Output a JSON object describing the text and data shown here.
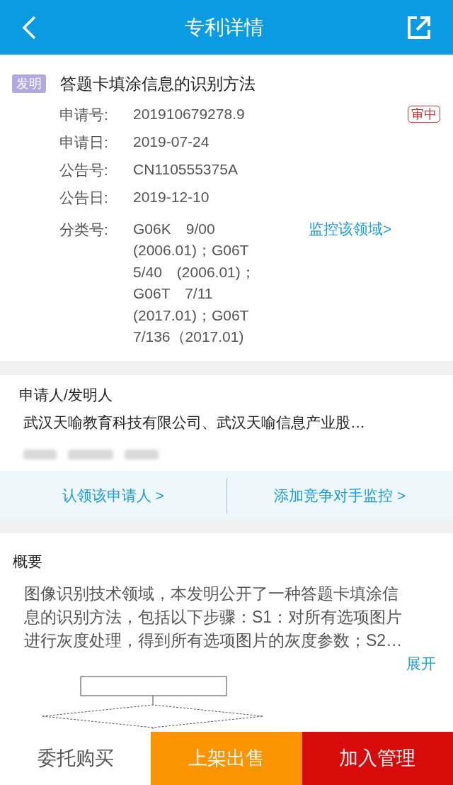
{
  "header": {
    "title": "专利详情"
  },
  "patent": {
    "type_tag": "发明",
    "title": "答题卡填涂信息的识别方法",
    "status": "审中",
    "fields": [
      {
        "label": "申请号:",
        "value": "201910679278.9"
      },
      {
        "label": "申请日:",
        "value": "2019-07-24"
      },
      {
        "label": "公告号:",
        "value": "CN110555375A"
      },
      {
        "label": "公告日:",
        "value": "2019-12-10"
      },
      {
        "label": "分类号:",
        "value": "G06K　9/00\n(2006.01)；G06T\n5/40　(2006.01)；\nG06T　7/11\n(2017.01)；G06T\n7/136（2017.01)"
      }
    ],
    "monitor_link": "监控该领域>"
  },
  "applicants": {
    "heading": "申请人/发明人",
    "names": "武汉天喻教育科技有限公司、武汉天喻信息产业股…",
    "actions": [
      "认领该申请人 >",
      "添加竞争对手监控 >"
    ]
  },
  "summary": {
    "heading": "概要",
    "text": "图像识别技术领域，本发明公开了一种答题卡填涂信息的识别方法，包括以下步骤：S1：对所有选项图片进行灰度处理，得到所有选项图片的灰度参数；S2…",
    "expand": "展开"
  },
  "bottom_bar": [
    {
      "label": "委托购买",
      "kind": "plain"
    },
    {
      "label": "上架出售",
      "kind": "orange"
    },
    {
      "label": "加入管理",
      "kind": "red"
    }
  ]
}
